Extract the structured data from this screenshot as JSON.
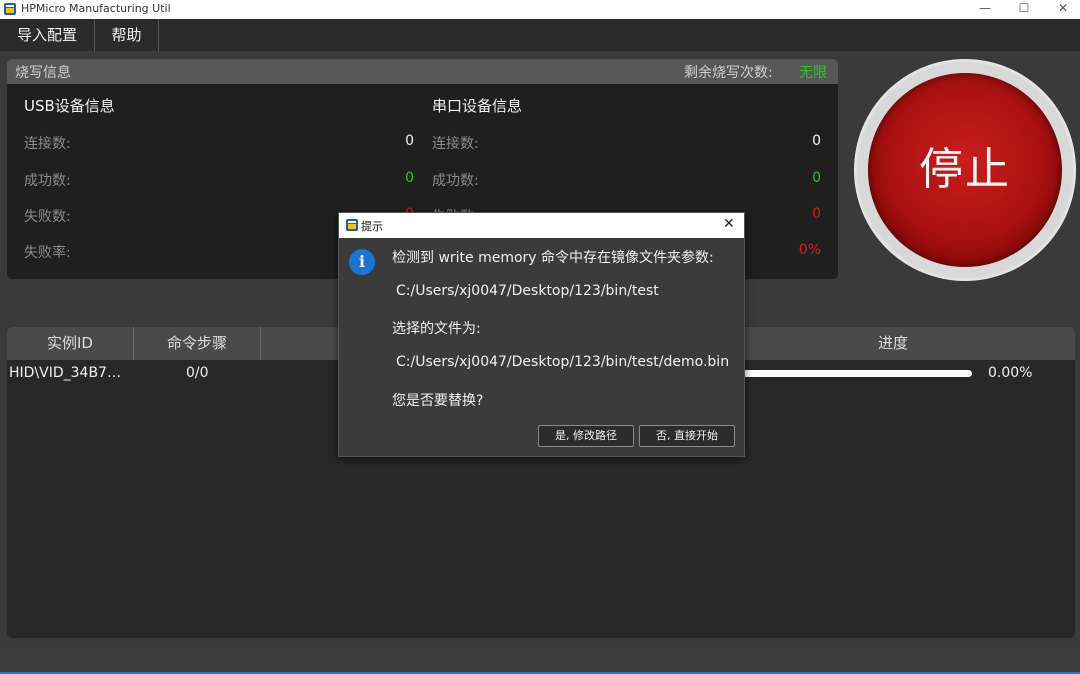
{
  "window": {
    "title": "HPMicro Manufacturing Util",
    "minimize": "—",
    "maximize": "☐",
    "close": "✕"
  },
  "menu": {
    "items": [
      {
        "label": "导入配置"
      },
      {
        "label": "帮助"
      }
    ]
  },
  "info": {
    "title": "烧写信息",
    "remain_label": "剩余烧写次数:",
    "remain_value": "无限",
    "usb": {
      "title": "USB设备信息",
      "connect_label": "连接数:",
      "connect_value": "0",
      "success_label": "成功数:",
      "success_value": "0",
      "fail_label": "失败数:",
      "fail_value": "0",
      "rate_label": "失败率:"
    },
    "serial": {
      "title": "串口设备信息",
      "connect_label": "连接数:",
      "connect_value": "0",
      "success_label": "成功数:",
      "success_value": "0",
      "fail_label": "失败数:",
      "fail_value": "0",
      "rate_value": "0%"
    }
  },
  "stop_button": {
    "label": "停止"
  },
  "table": {
    "columns": [
      "实例ID",
      "命令步骤",
      "进度"
    ],
    "rows": [
      {
        "id": "HID\\VID_34B7…",
        "step": "0/0",
        "progress": 0.0,
        "progress_text": "0.00%"
      }
    ]
  },
  "dialog": {
    "title": "提示",
    "close": "✕",
    "icon": "info-icon",
    "line1": "检测到 write memory 命令中存在镜像文件夹参数:",
    "line2": "C:/Users/xj0047/Desktop/123/bin/test",
    "line3": "选择的文件为:",
    "line4": "C:/Users/xj0047/Desktop/123/bin/test/demo.bin",
    "line5": "您是否要替换?",
    "yes_label": "是, 修改路径",
    "no_label": "否, 直接开始"
  },
  "colors": {
    "accent_green": "#22c922",
    "accent_red": "#d02020",
    "info_blue": "#1a74d2"
  }
}
